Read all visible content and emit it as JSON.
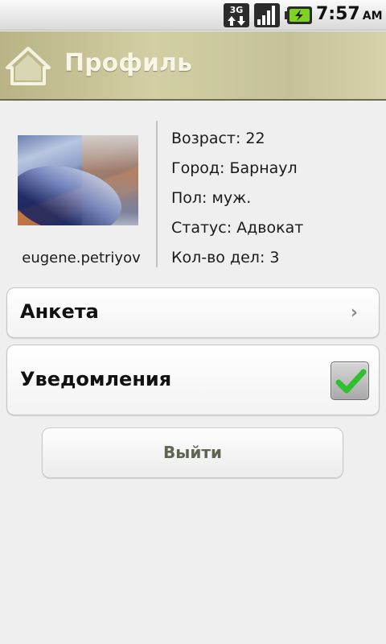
{
  "status_bar": {
    "network_label": "3G",
    "network_icon": "3g-data-icon",
    "signal_icon": "signal-strength-icon",
    "battery_icon": "battery-charging-icon",
    "time": "7:57",
    "ampm": "AM"
  },
  "header": {
    "home_icon": "home-icon",
    "title": "Профиль",
    "color": "#c7c39a"
  },
  "profile": {
    "username": "eugene.petriyov",
    "details": [
      "Возраст: 22",
      "Город: Барнаул",
      "Пол: муж.",
      "Статус: Адвокат",
      "Кол-во дел: 3"
    ]
  },
  "menu": {
    "anketa_label": "Анкета",
    "anketa_icon": "chevron-right-icon",
    "notifications_label": "Уведомления",
    "notifications_checked": true,
    "checkmark_color": "#2fbf2f"
  },
  "logout_label": "Выйти"
}
